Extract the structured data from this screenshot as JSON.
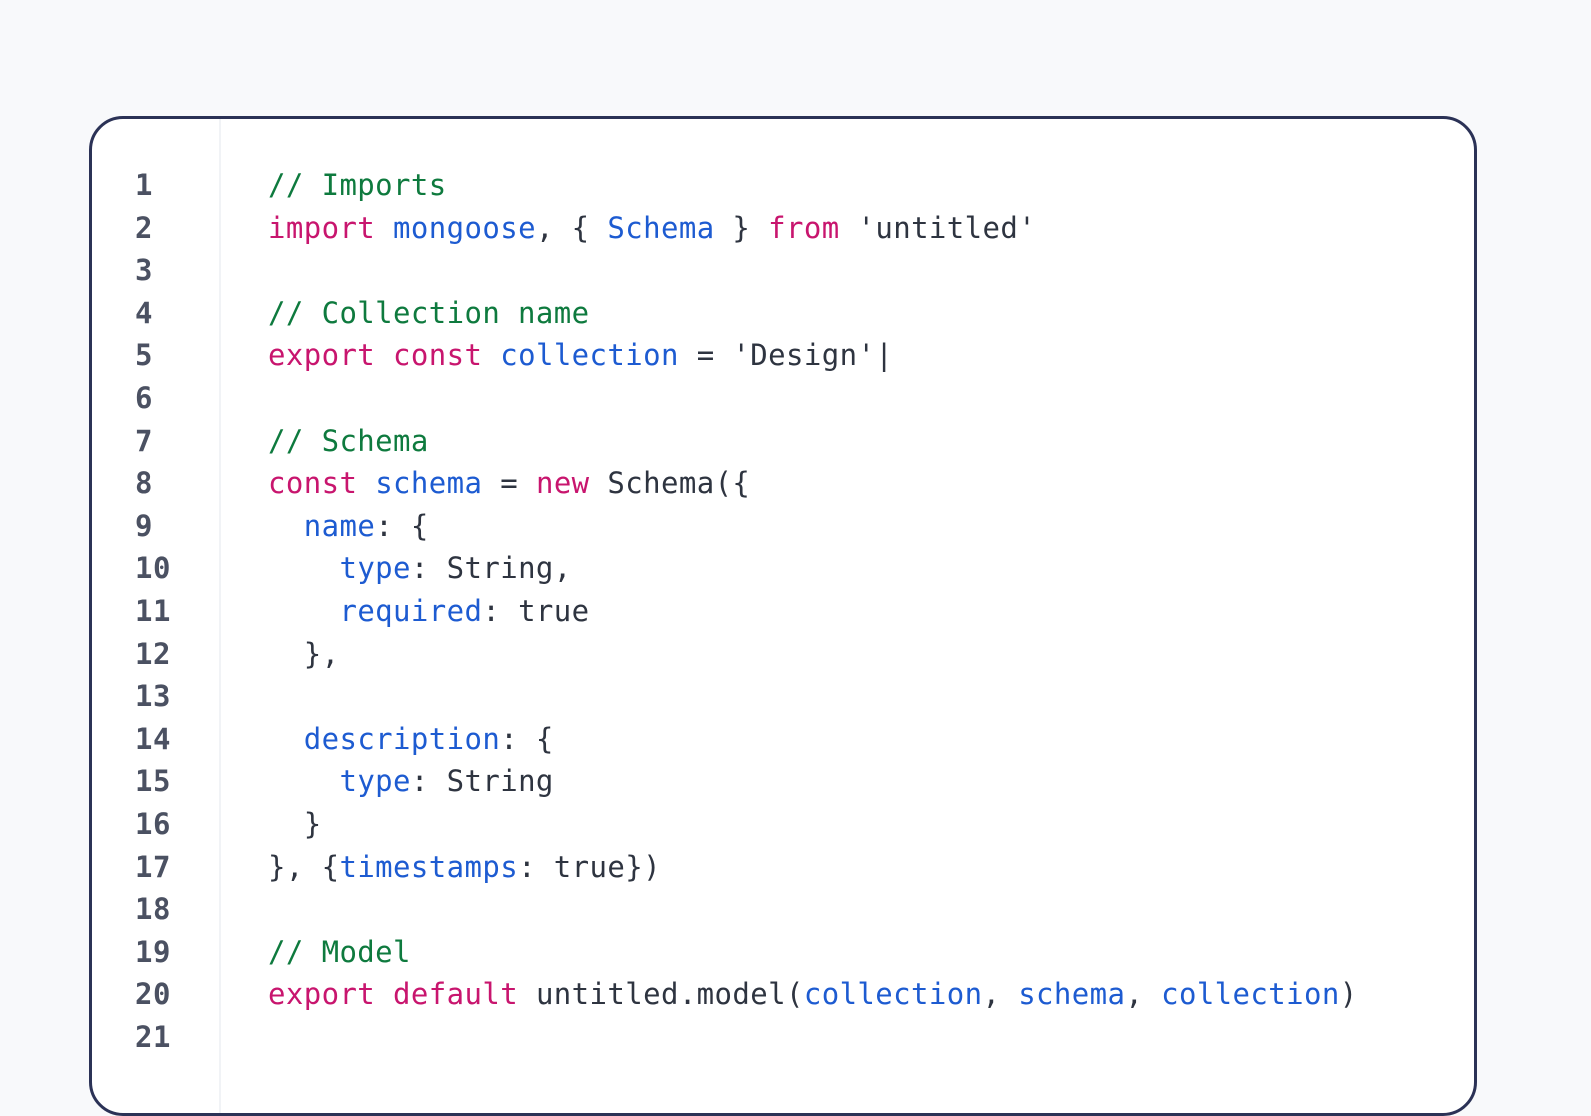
{
  "editor": {
    "line_numbers": [
      "1",
      "2",
      "3",
      "4",
      "5",
      "6",
      "7",
      "8",
      "9",
      "10",
      "11",
      "12",
      "13",
      "14",
      "15",
      "16",
      "17",
      "18",
      "19",
      "20",
      "21"
    ],
    "lines": [
      [
        {
          "t": "cm",
          "v": "// Imports"
        }
      ],
      [
        {
          "t": "kw",
          "v": "import"
        },
        {
          "t": "pl",
          "v": " "
        },
        {
          "t": "id",
          "v": "mongoose"
        },
        {
          "t": "pl",
          "v": ", { "
        },
        {
          "t": "id",
          "v": "Schema"
        },
        {
          "t": "pl",
          "v": " } "
        },
        {
          "t": "kw",
          "v": "from"
        },
        {
          "t": "pl",
          "v": " "
        },
        {
          "t": "st",
          "v": "'untitled'"
        }
      ],
      [],
      [
        {
          "t": "cm",
          "v": "// Collection name"
        }
      ],
      [
        {
          "t": "kw",
          "v": "export"
        },
        {
          "t": "pl",
          "v": " "
        },
        {
          "t": "kw",
          "v": "const"
        },
        {
          "t": "pl",
          "v": " "
        },
        {
          "t": "id",
          "v": "collection"
        },
        {
          "t": "pl",
          "v": " = "
        },
        {
          "t": "st",
          "v": "'Design'"
        },
        {
          "t": "caret",
          "v": "|"
        }
      ],
      [],
      [
        {
          "t": "cm",
          "v": "// Schema"
        }
      ],
      [
        {
          "t": "kw",
          "v": "const"
        },
        {
          "t": "pl",
          "v": " "
        },
        {
          "t": "id",
          "v": "schema"
        },
        {
          "t": "pl",
          "v": " = "
        },
        {
          "t": "kw",
          "v": "new"
        },
        {
          "t": "pl",
          "v": " Schema({"
        }
      ],
      [
        {
          "t": "pl",
          "v": "  "
        },
        {
          "t": "id",
          "v": "name"
        },
        {
          "t": "pl",
          "v": ": {"
        }
      ],
      [
        {
          "t": "pl",
          "v": "    "
        },
        {
          "t": "id",
          "v": "type"
        },
        {
          "t": "pl",
          "v": ": String,"
        }
      ],
      [
        {
          "t": "pl",
          "v": "    "
        },
        {
          "t": "id",
          "v": "required"
        },
        {
          "t": "pl",
          "v": ": true"
        }
      ],
      [
        {
          "t": "pl",
          "v": "  },"
        }
      ],
      [],
      [
        {
          "t": "pl",
          "v": "  "
        },
        {
          "t": "id",
          "v": "description"
        },
        {
          "t": "pl",
          "v": ": {"
        }
      ],
      [
        {
          "t": "pl",
          "v": "    "
        },
        {
          "t": "id",
          "v": "type"
        },
        {
          "t": "pl",
          "v": ": String"
        }
      ],
      [
        {
          "t": "pl",
          "v": "  }"
        }
      ],
      [
        {
          "t": "pl",
          "v": "}, {"
        },
        {
          "t": "id",
          "v": "timestamps"
        },
        {
          "t": "pl",
          "v": ": true})"
        }
      ],
      [],
      [
        {
          "t": "cm",
          "v": "// Model"
        }
      ],
      [
        {
          "t": "kw",
          "v": "export"
        },
        {
          "t": "pl",
          "v": " "
        },
        {
          "t": "kw",
          "v": "default"
        },
        {
          "t": "pl",
          "v": " untitled.model("
        },
        {
          "t": "id",
          "v": "collection"
        },
        {
          "t": "pl",
          "v": ", "
        },
        {
          "t": "id",
          "v": "schema"
        },
        {
          "t": "pl",
          "v": ", "
        },
        {
          "t": "id",
          "v": "collection"
        },
        {
          "t": "pl",
          "v": ")"
        }
      ],
      []
    ]
  },
  "colors": {
    "keyword": "#c8156e",
    "identifier": "#1d5bd1",
    "comment": "#0e7a3e",
    "plain": "#2e3440",
    "line_number": "#4b5162",
    "border": "#2b3256",
    "background": "#f8f9fb"
  }
}
